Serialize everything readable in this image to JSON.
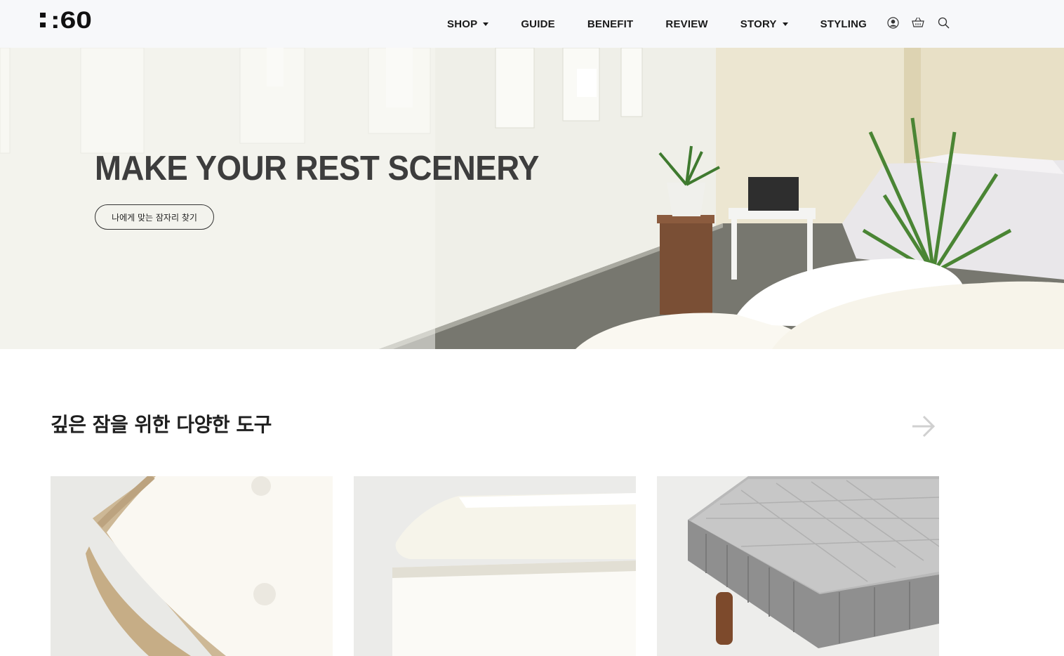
{
  "brand": {
    "logo_text": ":60"
  },
  "nav": {
    "items": [
      {
        "label": "SHOP",
        "dropdown": true
      },
      {
        "label": "GUIDE",
        "dropdown": false
      },
      {
        "label": "BENEFIT",
        "dropdown": false
      },
      {
        "label": "REVIEW",
        "dropdown": false
      },
      {
        "label": "STORY",
        "dropdown": true
      },
      {
        "label": "STYLING",
        "dropdown": false
      }
    ],
    "icons": [
      "user-icon",
      "basket-icon",
      "search-icon"
    ]
  },
  "hero": {
    "title": "MAKE YOUR REST SCENERY",
    "button_label": "나에게 맞는 잠자리 찾기"
  },
  "section": {
    "title": "깊은 잠을 위한 다양한 도구",
    "next_icon": "arrow-right-icon"
  },
  "products": [
    {
      "image": "mattress-corner-image"
    },
    {
      "image": "pillow-topper-image"
    },
    {
      "image": "grey-bed-base-image"
    }
  ],
  "colors": {
    "nav_bg": "#f7f8fa",
    "text_dark": "#1a1a1a",
    "hero_title": "#3d3d3d"
  }
}
